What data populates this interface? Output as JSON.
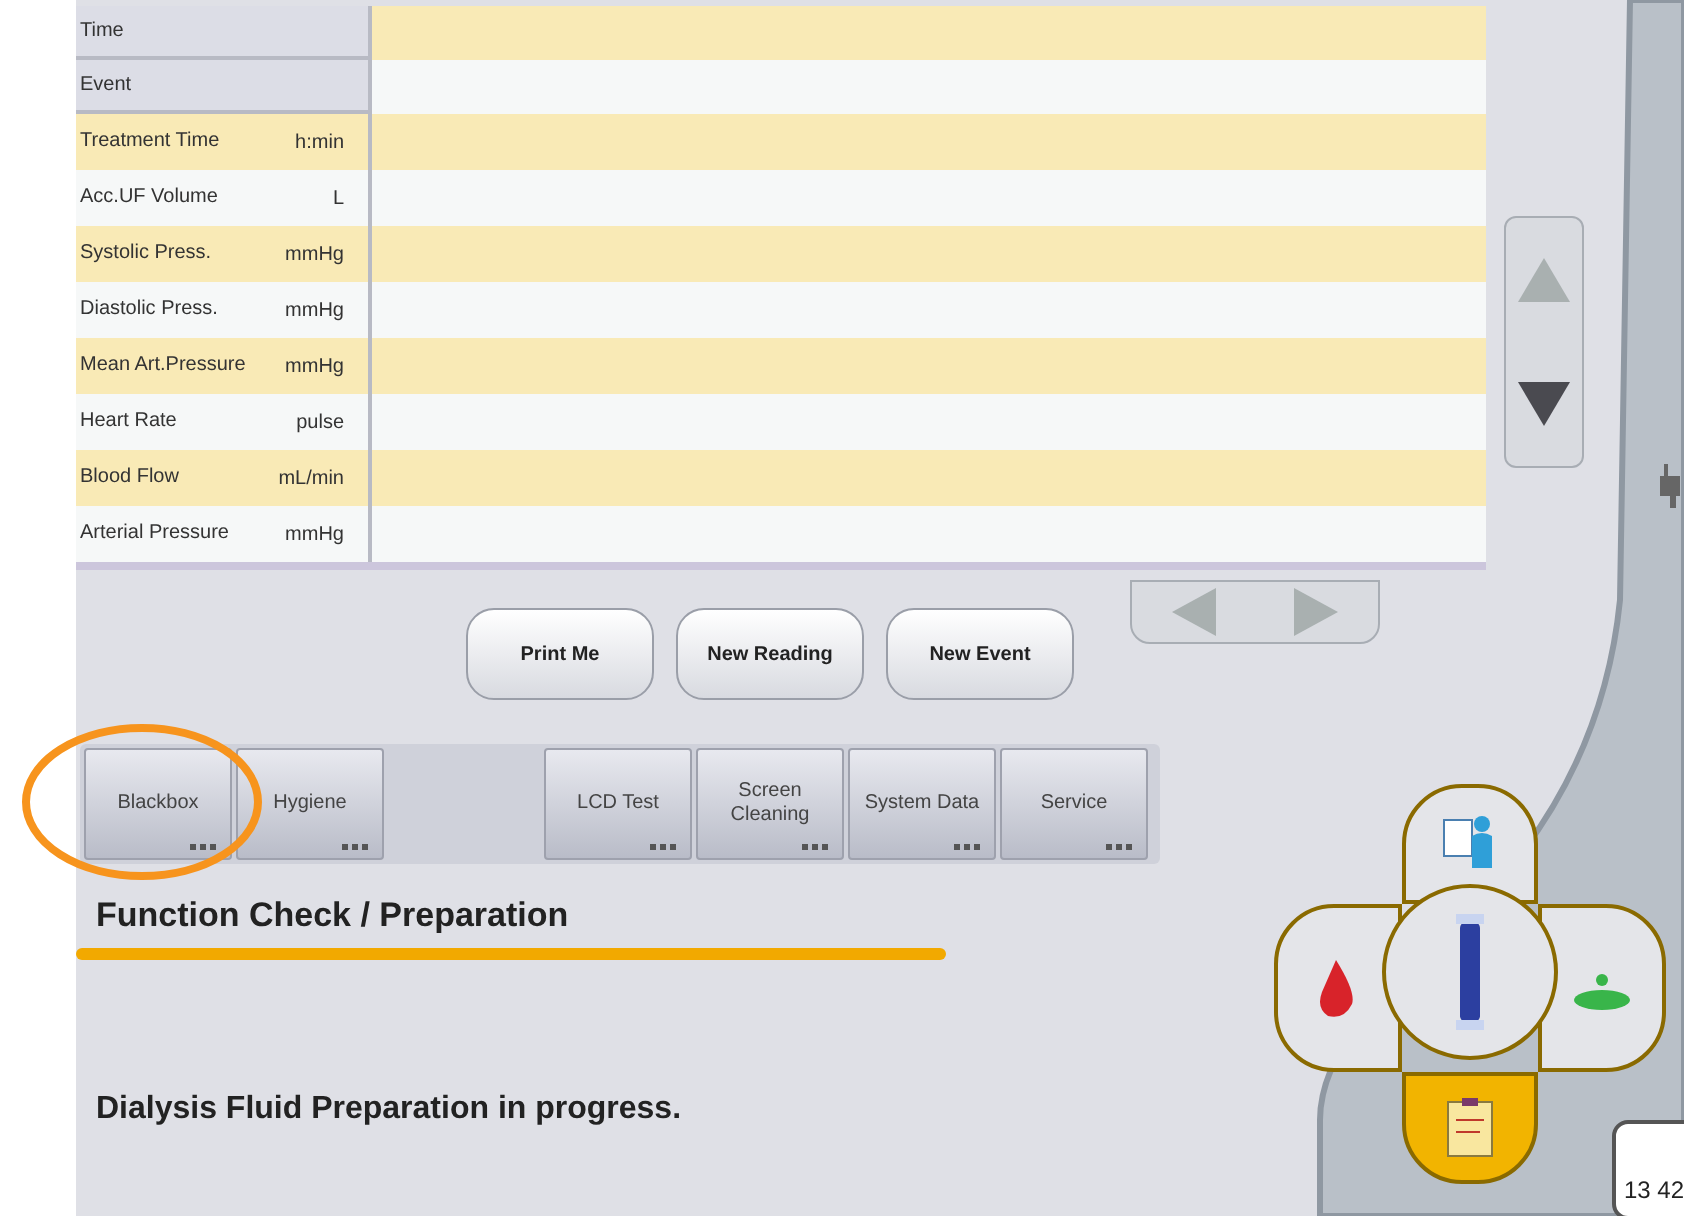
{
  "table": {
    "header_rows": [
      {
        "label": "Time"
      },
      {
        "label": "Event"
      }
    ],
    "rows": [
      {
        "label": "Treatment Time",
        "unit": "h:min"
      },
      {
        "label": "Acc.UF Volume",
        "unit": "L"
      },
      {
        "label": "Systolic Press.",
        "unit": "mmHg"
      },
      {
        "label": "Diastolic Press.",
        "unit": "mmHg"
      },
      {
        "label": "Mean Art.Pressure",
        "unit": "mmHg"
      },
      {
        "label": "Heart Rate",
        "unit": "pulse"
      },
      {
        "label": "Blood Flow",
        "unit": "mL/min"
      },
      {
        "label": "Arterial Pressure",
        "unit": "mmHg"
      }
    ]
  },
  "actions": [
    "Print Me",
    "New Reading",
    "New Event"
  ],
  "function_tabs": [
    {
      "label": "Blackbox",
      "highlighted": true,
      "gap_after": false
    },
    {
      "label": "Hygiene",
      "highlighted": false,
      "gap_after": true
    },
    {
      "label": "LCD Test",
      "highlighted": false,
      "gap_after": false
    },
    {
      "label": "Screen Cleaning",
      "highlighted": false,
      "gap_after": false
    },
    {
      "label": "System Data",
      "highlighted": false,
      "gap_after": false
    },
    {
      "label": "Service",
      "highlighted": false,
      "gap_after": false
    }
  ],
  "section_title": "Function Check / Preparation",
  "status_message": "Dialysis Fluid Preparation in progress.",
  "nav_pad": [
    {
      "kind": "patient",
      "selected": false
    },
    {
      "kind": "blood",
      "selected": false
    },
    {
      "kind": "dialyzer",
      "selected": false
    },
    {
      "kind": "fluid",
      "selected": false
    },
    {
      "kind": "protocol",
      "selected": true
    }
  ],
  "clock": "13 42"
}
